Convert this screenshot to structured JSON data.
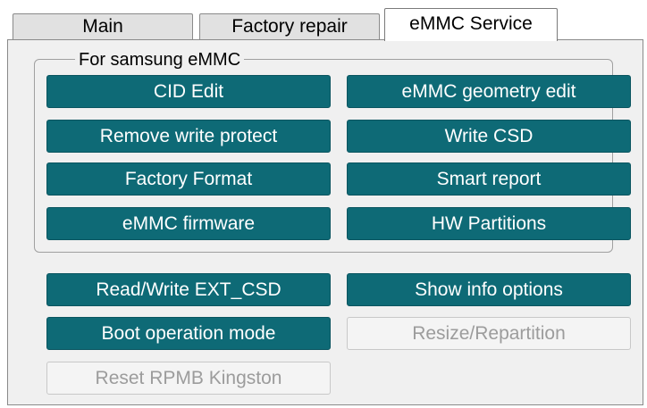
{
  "tabs": [
    {
      "label": "Main",
      "active": false
    },
    {
      "label": "Factory repair",
      "active": false
    },
    {
      "label": "eMMC Service",
      "active": true
    }
  ],
  "group": {
    "title": "For samsung eMMC",
    "buttons": [
      "CID Edit",
      "eMMC geometry edit",
      "Remove write protect",
      "Write CSD",
      "Factory Format",
      "Smart report",
      "eMMC firmware",
      "HW Partitions"
    ]
  },
  "buttons": [
    {
      "label": "Read/Write EXT_CSD",
      "enabled": true
    },
    {
      "label": "Show info options",
      "enabled": true
    },
    {
      "label": "Boot operation mode",
      "enabled": true
    },
    {
      "label": "Resize/Repartition",
      "enabled": false
    },
    {
      "label": "Reset RPMB Kingston",
      "enabled": false
    }
  ],
  "colors": {
    "button_bg": "#0e6a76",
    "button_text": "#ffffff",
    "disabled_text": "#9c9c9c"
  }
}
